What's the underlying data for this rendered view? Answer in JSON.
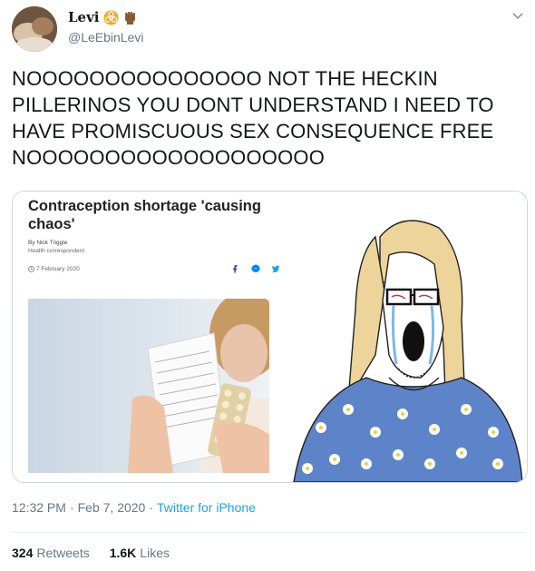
{
  "author": {
    "display_name": "Levi",
    "handle": "@LeEbinLevi",
    "avatar": "avatar-photo",
    "badges": [
      "biohazard-icon",
      "raised-fist-icon"
    ]
  },
  "tweet": {
    "text": "NOOOOOOOOOOOOOOO NOT THE HECKIN PILLERINOS YOU DONT UNDERSTAND I NEED TO HAVE PROMISCUOUS SEX CONSEQUENCE FREE NOOOOOOOOOOOOOOOOOOO"
  },
  "article": {
    "headline": "Contraception shortage 'causing chaos'",
    "byline": "By Nick Triggle",
    "role": "Health correspondent",
    "date": "7 February 2020",
    "share_icons": [
      "facebook-icon",
      "messenger-icon",
      "twitter-icon"
    ]
  },
  "meta": {
    "time": "12:32 PM",
    "separator": "·",
    "date": "Feb 7, 2020",
    "separator2": "·",
    "source": "Twitter for iPhone"
  },
  "stats": {
    "retweets_count": "324",
    "retweets_label": "Retweets",
    "likes_count": "1.6K",
    "likes_label": "Likes"
  },
  "colors": {
    "text": "#14171a",
    "secondary": "#657786",
    "link": "#1da1f2",
    "border": "#ccd6dd"
  }
}
